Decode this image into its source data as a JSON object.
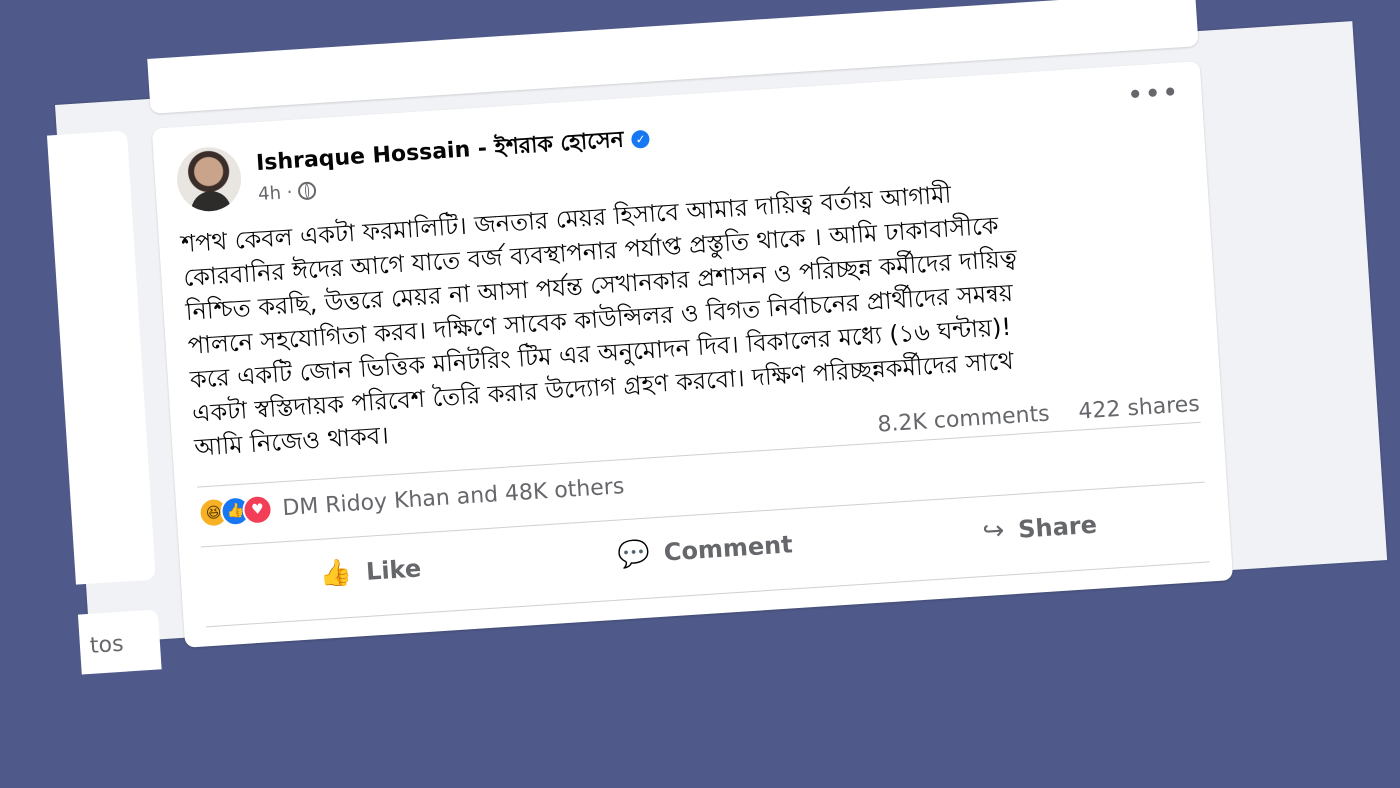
{
  "post": {
    "author": "Ishraque Hossain - ইশরাক হোসেন",
    "time": "4h ·",
    "more_label": "•••",
    "body_lines": [
      "শপথ কেবল একটা ফরমালিটি। জনতার মেয়র হিসাবে আমার দায়িত্ব বর্তায় আগামী",
      "কোরবানির ঈদের আগে যাতে বর্জ ব্যবস্থাপনার পর্যাপ্ত প্রস্তুতি থাকে । আমি ঢাকাবাসীকে",
      "নিশ্চিত করছি, উত্তরে মেয়র না আসা পর্যন্ত সেখানকার প্রশাসন ও পরিচ্ছন্ন কর্মীদের দায়িত্ব",
      "পালনে সহযোগিতা করব। দক্ষিণে সাবেক কাউন্সিলর ও বিগত নির্বাচনের প্রার্থীদের সমন্বয়",
      "করে একটি জোন ভিত্তিক মনিটরিং টিম এর অনুমোদন দিব। বিকালের মধ্যে (১৬ ঘন্টায়)!",
      "একটা স্বস্তিদায়ক পরিবেশ তৈরি করার উদ্যোগ গ্রহণ করবো। দক্ষিণ পরিচ্ছন্নকর্মীদের সাথে",
      "আমি নিজেও থাকব।"
    ],
    "comments": "8.2K comments",
    "shares": "422 shares",
    "reactions_text": "DM Ridoy Khan and 48K others",
    "reaction_icons": [
      "haha-icon",
      "like-icon",
      "love-icon"
    ],
    "actions": {
      "like": "Like",
      "comment": "Comment",
      "share": "Share"
    }
  },
  "side": {
    "label": "tos"
  },
  "colors": {
    "background": "#4f5a8a",
    "accent": "#1877f2"
  }
}
